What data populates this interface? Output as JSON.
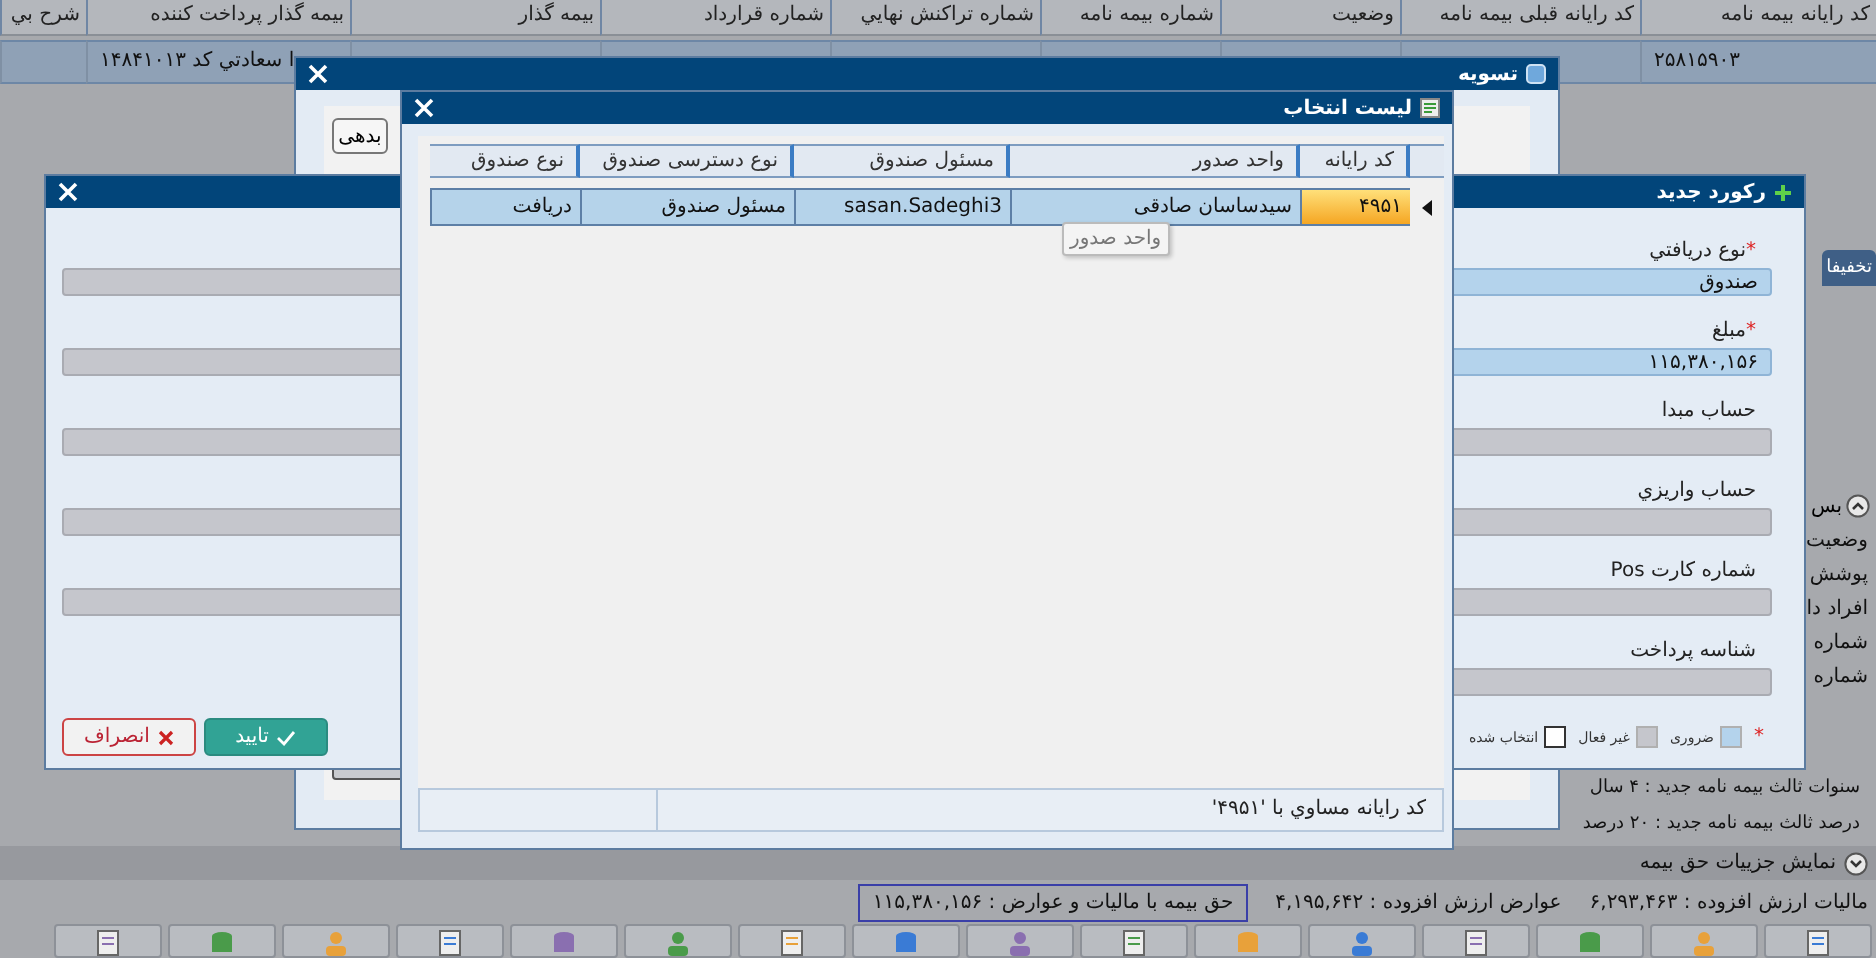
{
  "background": {
    "columns": [
      "كد رايانه بيمه نامه",
      "كد رايانه قبلی بيمه نامه",
      "وضعيت",
      "شماره بيمه نامه",
      "شماره تراكنش نهايي",
      "شماره قرارداد",
      "بيمه گذار",
      "بيمه گذار پرداخت كننده",
      "شرح بي"
    ],
    "row": {
      "selected": true,
      "cells": [
        "۲۵۸۱۵۹۰۳",
        "",
        "",
        "",
        "",
        "",
        "",
        "ا سعادتي كد ۱۴۸۴۱۰۱۳",
        ""
      ]
    },
    "side_panel": {
      "tab": "تخفيفا",
      "section": "بس",
      "labels": [
        "وضعيت",
        "پوشش",
        "افراد دا",
        "شماره",
        "شماره"
      ]
    },
    "summary": [
      "سنوات ثالث بيمه نامه جديد : ۴ سال",
      "درصد ثالث بيمه نامه جديد : ۲۰ درصد"
    ],
    "details_toggle": "نمايش جزييات حق بيمه",
    "totals": [
      {
        "text": "ماليات ارزش افزوده  :  ۶,۲۹۳,۴۶۳",
        "highlighted": false
      },
      {
        "text": "عوارض ارزش افزوده  :  ۴,۱۹۵,۶۴۲",
        "highlighted": false
      },
      {
        "text": "حق بيمه با ماليات و عوارض  :  ۱۱۵,۳۸۰,۱۵۶",
        "highlighted": true
      }
    ]
  },
  "settlement_dialog": {
    "title": "تسويه",
    "debt_button": "بدهی"
  },
  "record_dialog": {
    "title": "ركورد جديد",
    "fields": [
      {
        "label": "نوع دريافتي",
        "required": true,
        "value": "صندوق"
      },
      {
        "label": "مبلغ",
        "required": true,
        "value": "۱۱۵,۳۸۰,۱۵۶"
      },
      {
        "label": "حساب مبدا",
        "required": false
      },
      {
        "label": "حساب واريزي",
        "required": false
      },
      {
        "label": "شماره كارت Pos",
        "required": false
      },
      {
        "label": "شناسه پرداخت",
        "required": false
      }
    ],
    "second_column": [
      {
        "required": false
      },
      {
        "required": false
      },
      {
        "required": false
      },
      {
        "required": false
      },
      {
        "required": false
      }
    ],
    "legend_mark": "*",
    "legend": [
      {
        "label": "ضروری",
        "kind": "required"
      },
      {
        "label": "غير فعال",
        "kind": "disabled"
      },
      {
        "label": "انتخاب شده",
        "kind": "selected"
      }
    ],
    "buttons": [
      {
        "label": "تاييد",
        "kind": "confirm"
      },
      {
        "label": "انصراف",
        "kind": "cancel"
      }
    ]
  },
  "list_dialog": {
    "title": "ليست انتخاب",
    "columns": [
      "كد رايانه",
      "واحد صدور",
      "مسئول صندوق",
      "نوع دسترسی صندوق",
      "نوع صندوق"
    ],
    "rows": [
      {
        "selected": true,
        "cells": [
          "۴۹۵۱",
          "سیدساسان صادقی",
          "sasan.Sadeghi3",
          "مسئول صندوق",
          "دريافت"
        ]
      }
    ],
    "tooltip": "واحد صدور",
    "filter": "كد رايانه مساوي با '۴۹۵۱'"
  }
}
